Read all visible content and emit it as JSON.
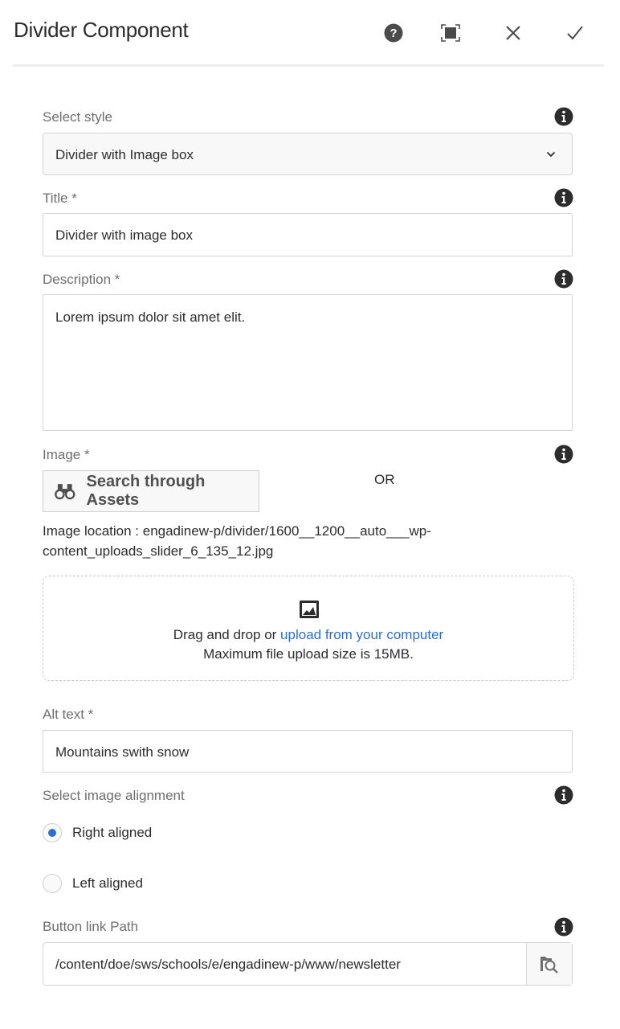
{
  "dialog": {
    "title": "Divider Component",
    "actions": {
      "help": "help-icon",
      "fullscreen": "fullscreen-icon",
      "close": "close-icon",
      "done": "check-icon"
    }
  },
  "form": {
    "select_style": {
      "label": "Select style",
      "value": "Divider with Image box"
    },
    "title": {
      "label": "Title *",
      "value": "Divider with image box"
    },
    "description": {
      "label": "Description *",
      "value": "Lorem ipsum dolor sit amet elit."
    },
    "image": {
      "label": "Image *",
      "search_button": "Search through Assets",
      "or_text": "OR",
      "location": "Image location : engadinew-p/divider/1600__1200__auto___wp-content_uploads_slider_6_135_12.jpg",
      "dropzone": {
        "prefix": "Drag and drop or ",
        "link": "upload from your computer",
        "max_size": "Maximum file upload size is 15MB."
      }
    },
    "alt_text": {
      "label": "Alt text *",
      "value": "Mountains swith snow"
    },
    "alignment": {
      "label": "Select image alignment",
      "options": [
        {
          "label": "Right aligned",
          "checked": true
        },
        {
          "label": "Left aligned",
          "checked": false
        }
      ]
    },
    "button_link": {
      "label": "Button link Path",
      "value": "/content/doe/sws/schools/e/engadinew-p/www/newsletter"
    }
  },
  "colors": {
    "accent": "#2c6fd1",
    "text": "#2c2c2c",
    "label": "#6e6e6e"
  }
}
